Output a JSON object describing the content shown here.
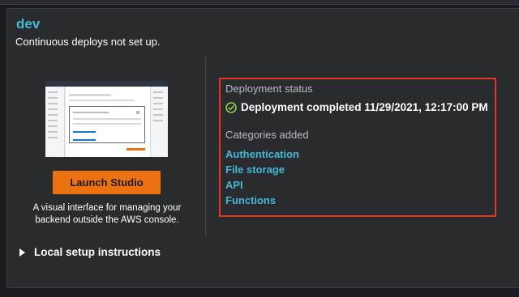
{
  "environment": {
    "name": "dev",
    "subtitle": "Continuous deploys not set up."
  },
  "studio": {
    "launch_label": "Launch Studio",
    "description": "A visual interface for managing your backend outside the AWS console."
  },
  "setup": {
    "label": "Local setup instructions",
    "expanded": false
  },
  "deployment": {
    "status_label": "Deployment status",
    "status_text": "Deployment completed 11/29/2021, 12:17:00 PM",
    "status_icon": "check-circle-icon",
    "status_color": "#8fd14f"
  },
  "categories": {
    "label": "Categories added",
    "items": [
      {
        "label": "Authentication"
      },
      {
        "label": "File storage"
      },
      {
        "label": "API"
      },
      {
        "label": "Functions"
      }
    ]
  },
  "colors": {
    "accent": "#44b9d6",
    "button": "#ec7211",
    "highlight_border": "#e0362c"
  }
}
